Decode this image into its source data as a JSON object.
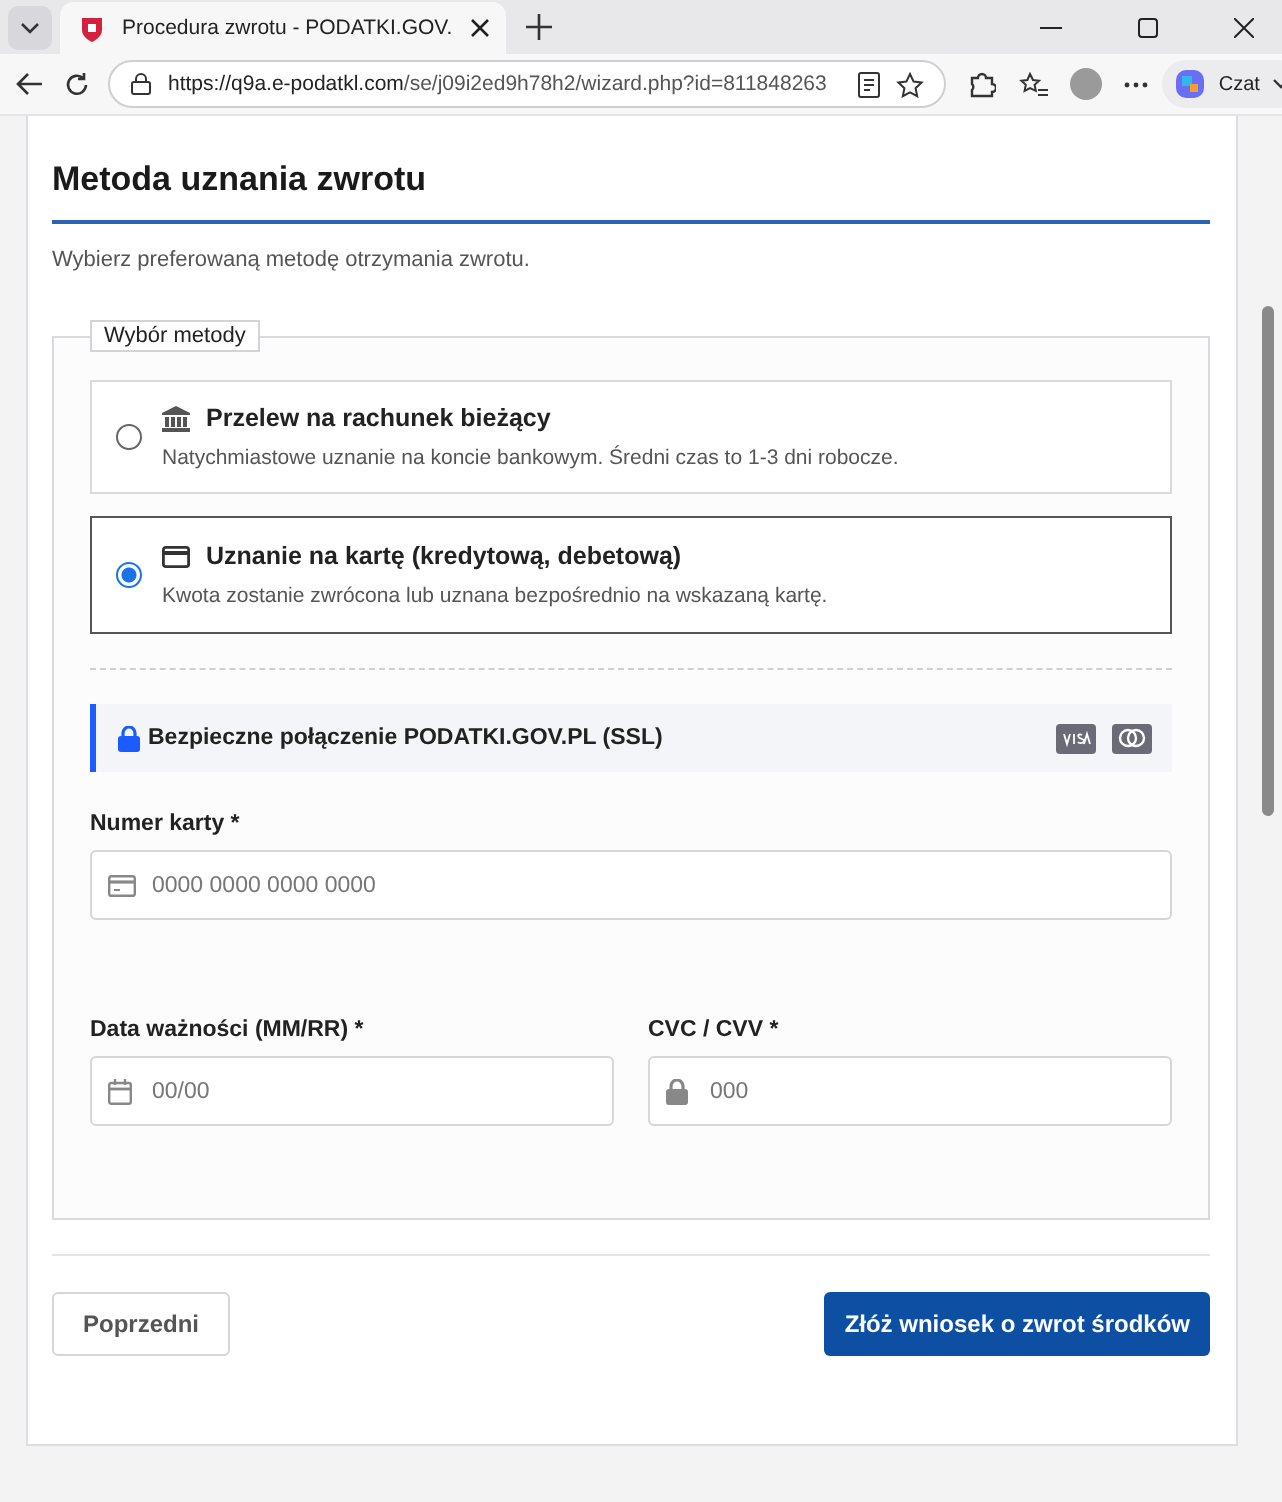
{
  "browser": {
    "tab_title": "Procedura zwrotu - PODATKI.GOV.",
    "url_host": "https://q9a.e-podatkl.com",
    "url_path": "/se/j09i2ed9h78h2/wizard.php?id=811848263",
    "copilot_label": "Czat"
  },
  "page": {
    "title": "Metoda uznania zwrotu",
    "subtitle": "Wybierz preferowaną metodę otrzymania zwrotu.",
    "fieldset_legend": "Wybór metody",
    "methods": [
      {
        "kind": "bank",
        "title": "Przelew na rachunek bieżący",
        "description": "Natychmiastowe uznanie na koncie bankowym. Średni czas to 1-3 dni robocze.",
        "selected": false
      },
      {
        "kind": "card",
        "title": "Uznanie na kartę (kredytową, debetową)",
        "description": "Kwota zostanie zwrócona lub uznana bezpośrednio na wskazaną kartę.",
        "selected": true
      }
    ],
    "secure_banner": "Bezpieczne połączenie PODATKI.GOV.PL (SSL)",
    "card_number": {
      "label": "Numer karty *",
      "placeholder": "0000 0000 0000 0000"
    },
    "expiry": {
      "label": "Data ważności (MM/RR) *",
      "placeholder": "00/00"
    },
    "cvc": {
      "label": "CVC / CVV *",
      "placeholder": "000"
    },
    "buttons": {
      "back": "Poprzedni",
      "submit": "Złóż wniosek o zwrot środków"
    }
  }
}
